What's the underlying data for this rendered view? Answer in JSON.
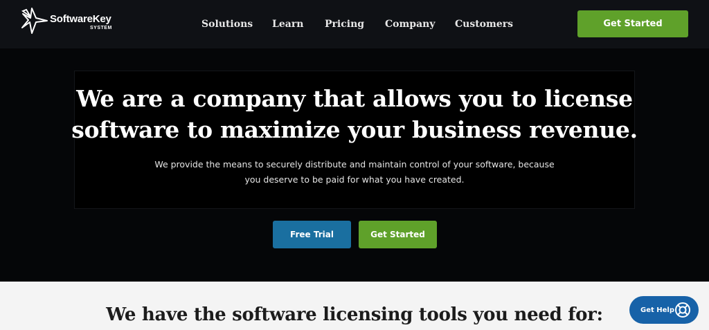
{
  "brand": {
    "name": "SoftwareKey",
    "subtitle": "SYSTEM"
  },
  "nav": {
    "items": [
      "Solutions",
      "Learn",
      "Pricing",
      "Company",
      "Customers"
    ]
  },
  "header": {
    "cta_label": "Get Started"
  },
  "hero": {
    "title_line1": "We are a company that allows you to license",
    "title_line2": "software to maximize your business revenue.",
    "subtitle_line1": "We provide the means to securely distribute and maintain control of your software, because",
    "subtitle_line2": "you deserve to be paid for what you have created.",
    "free_trial_label": "Free Trial",
    "get_started_label": "Get Started"
  },
  "section": {
    "title": "We have the software licensing tools you need for:"
  },
  "help_widget": {
    "label": "Get Help",
    "icon": "lifebuoy-icon"
  },
  "colors": {
    "header_bg": "#0f1115",
    "hero_bg": "#050608",
    "accent_green": "#5fa12a",
    "accent_blue": "#1a6fa0",
    "help_blue": "#1762a8"
  }
}
